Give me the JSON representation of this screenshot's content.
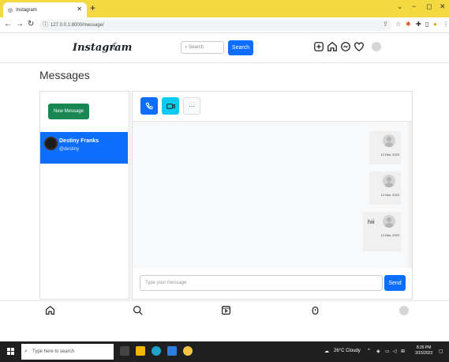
{
  "browser": {
    "tab_title": "Instagram",
    "new_tab": "+",
    "url": "127.0.0.1:8000/message/",
    "window_controls": [
      "⌄",
      "−",
      "◻",
      "✕"
    ]
  },
  "navbar": {
    "logo": "Instagram",
    "search_placeholder": "Search",
    "search_button": "Search"
  },
  "page": {
    "title": "Messages"
  },
  "sidebar": {
    "new_message_button": "New Message",
    "conversations": [
      {
        "name": "Destiny Franks",
        "username": "@destiny"
      }
    ]
  },
  "chat": {
    "toolbar": {
      "more_label": "···"
    },
    "messages": [
      {
        "text": "",
        "time": "12 Mar, 2023"
      },
      {
        "text": "",
        "time": "12 Mar, 2023"
      },
      {
        "text": "hiii",
        "time": "12 Mar, 2023"
      }
    ],
    "composer_placeholder": "Type your message",
    "send_button": "Send"
  },
  "taskbar": {
    "search_placeholder": "Type here to search",
    "weather": "26°C Cloudy",
    "time": "8:26 PM",
    "date": "3/15/2023"
  },
  "colors": {
    "primary": "#0d6efd",
    "success": "#198754",
    "info": "#0dcaf0",
    "tabbar": "#f5d940"
  }
}
